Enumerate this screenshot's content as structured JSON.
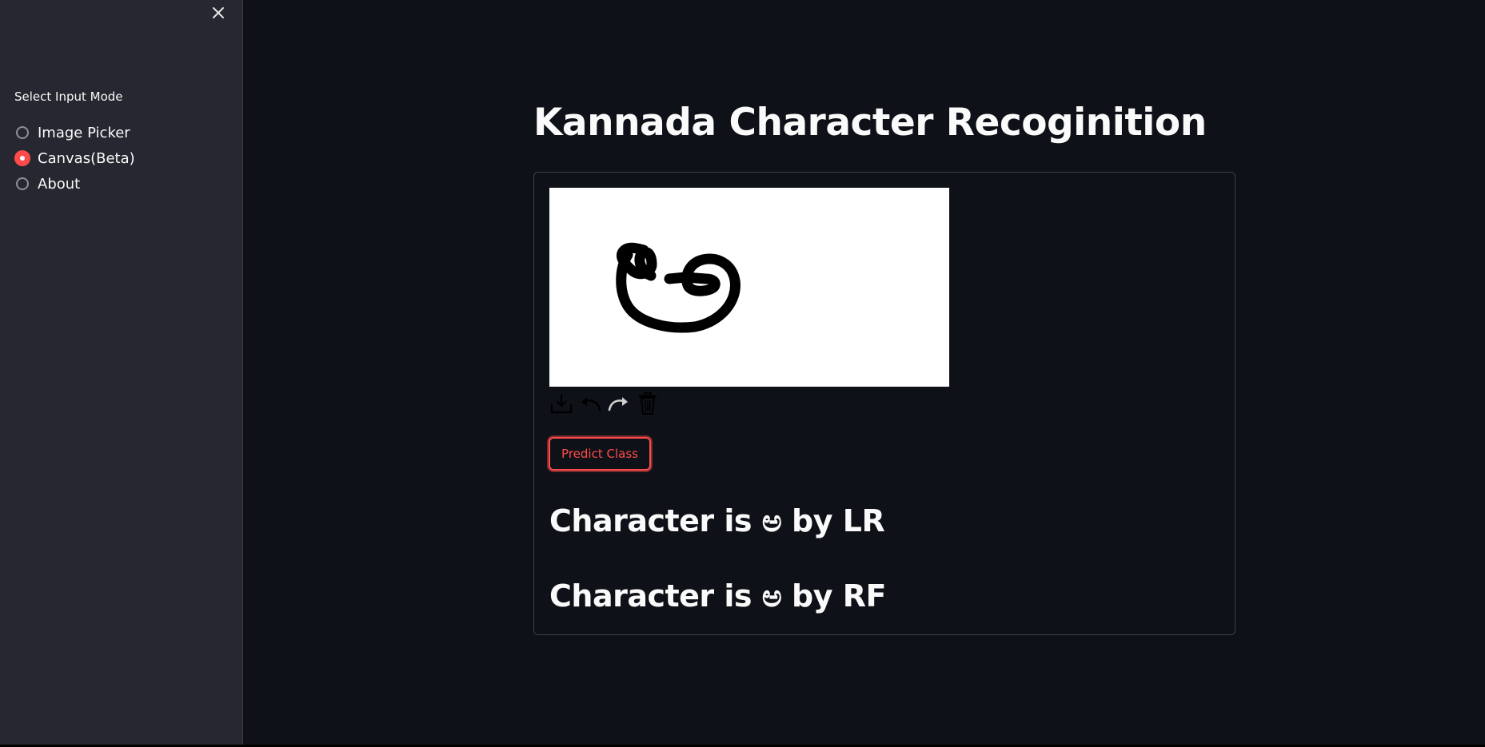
{
  "sidebar": {
    "close_icon": "close-icon",
    "label": "Select Input Mode",
    "options": [
      {
        "label": "Image Picker",
        "selected": false
      },
      {
        "label": "Canvas(Beta)",
        "selected": true
      },
      {
        "label": "About",
        "selected": false
      }
    ]
  },
  "main": {
    "title": "Kannada Character Recoginition",
    "toolbar_icons": [
      "download-icon",
      "undo-icon",
      "redo-icon",
      "trash-icon"
    ],
    "predict_button": "Predict Class",
    "results": {
      "lr": "Character is ಅ by LR",
      "rf": "Character is ಅ by RF"
    }
  },
  "colors": {
    "background": "#0e1117",
    "sidebar": "#262730",
    "accent": "#ff4b4b",
    "text": "#fafafa"
  }
}
